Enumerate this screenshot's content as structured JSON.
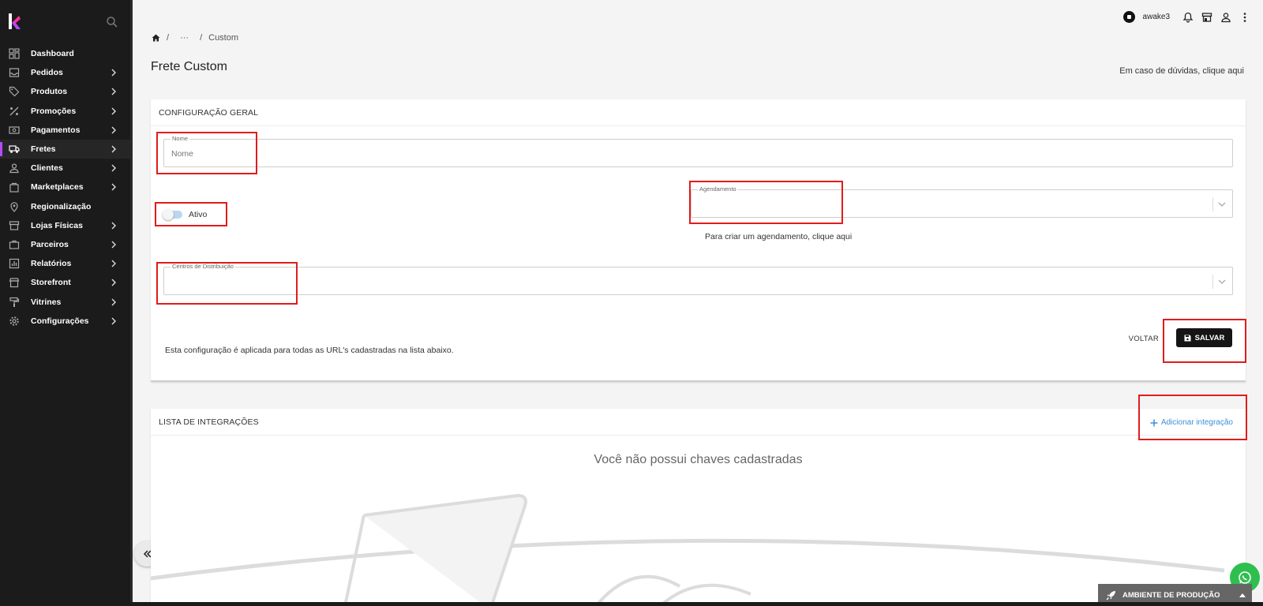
{
  "sidebar": {
    "items": [
      {
        "label": "Dashboard",
        "icon": "dashboard-icon",
        "chevron": false
      },
      {
        "label": "Pedidos",
        "icon": "inbox-icon",
        "chevron": true
      },
      {
        "label": "Produtos",
        "icon": "tag-icon",
        "chevron": true
      },
      {
        "label": "Promoções",
        "icon": "percent-icon",
        "chevron": true
      },
      {
        "label": "Pagamentos",
        "icon": "payment-icon",
        "chevron": true
      },
      {
        "label": "Fretes",
        "icon": "truck-icon",
        "chevron": true,
        "active": true
      },
      {
        "label": "Clientes",
        "icon": "person-icon",
        "chevron": true
      },
      {
        "label": "Marketplaces",
        "icon": "bag-icon",
        "chevron": true
      },
      {
        "label": "Regionalização",
        "icon": "location-icon",
        "chevron": false
      },
      {
        "label": "Lojas Físicas",
        "icon": "store-icon",
        "chevron": true
      },
      {
        "label": "Parceiros",
        "icon": "briefcase-icon",
        "chevron": true
      },
      {
        "label": "Relatórios",
        "icon": "chart-icon",
        "chevron": true
      },
      {
        "label": "Storefront",
        "icon": "storefront-icon",
        "chevron": true
      },
      {
        "label": "Vitrines",
        "icon": "paint-roller-icon",
        "chevron": true
      },
      {
        "label": "Configurações",
        "icon": "gear-icon",
        "chevron": true
      }
    ],
    "accent": "#b34bff"
  },
  "topbar": {
    "user": "awake3"
  },
  "breadcrumb": {
    "sep1": "/",
    "ellipsis": "···",
    "sep2": "/",
    "current": "Custom"
  },
  "page": {
    "title": "Frete Custom",
    "help": "Em caso de dúvidas, clique aqui"
  },
  "config": {
    "header": "CONFIGURAÇÃO GERAL",
    "name_label": "Nome",
    "name_placeholder": "Nome",
    "active_label": "Ativo",
    "schedule_label": "Agendamento",
    "schedule_help": "Para criar um agendamento, clique aqui",
    "dc_label": "Centros de Distribuição",
    "note": "Esta configuração é aplicada para todas as URL's cadastradas na lista abaixo.",
    "back_label": "VOLTAR",
    "save_label": "SALVAR"
  },
  "integrations": {
    "header": "LISTA DE INTEGRAÇÕES",
    "add_label": "Adicionar integração",
    "empty": "Você não possui chaves cadastradas"
  },
  "environment": {
    "label": "AMBIENTE DE PRODUÇÃO"
  },
  "colors": {
    "highlight": "#e21b1b",
    "link": "#3b8fd9",
    "whatsapp": "#2fbf4f"
  }
}
